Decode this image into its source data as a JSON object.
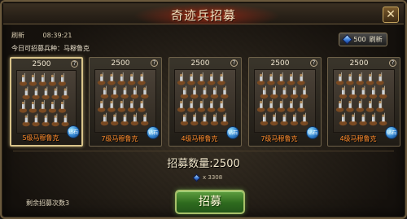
{
  "window": {
    "title": "奇迹兵招募",
    "close_label": "✕"
  },
  "refresh": {
    "label": "刷新",
    "timer": "08:39:21"
  },
  "today_text": "今日可招募兵种：马穆鲁克",
  "refresh_button": {
    "amount": "500",
    "label": "刷新",
    "icon": "gem-icon"
  },
  "cards": [
    {
      "cost": "2500",
      "name": "5级马穆鲁克",
      "badge": "钻石",
      "selected": true
    },
    {
      "cost": "2500",
      "name": "7级马穆鲁克",
      "badge": "钻石",
      "selected": false
    },
    {
      "cost": "2500",
      "name": "4级马穆鲁克",
      "badge": "钻石",
      "selected": false
    },
    {
      "cost": "2500",
      "name": "7级马穆鲁克",
      "badge": "钻石",
      "selected": false
    },
    {
      "cost": "2500",
      "name": "4级马穆鲁克",
      "badge": "钻石",
      "selected": false
    }
  ],
  "help_symbol": "?",
  "recruit_count_text": "招募数量:2500",
  "cost_line": {
    "icon": "gem-icon",
    "text": "x 3308"
  },
  "remaining_text": "剩余招募次数3",
  "recruit_button_label": "招募",
  "colors": {
    "accent_red": "#b03010",
    "unit_name": "#ff8a2a",
    "button_green": "#2e6a1e"
  }
}
